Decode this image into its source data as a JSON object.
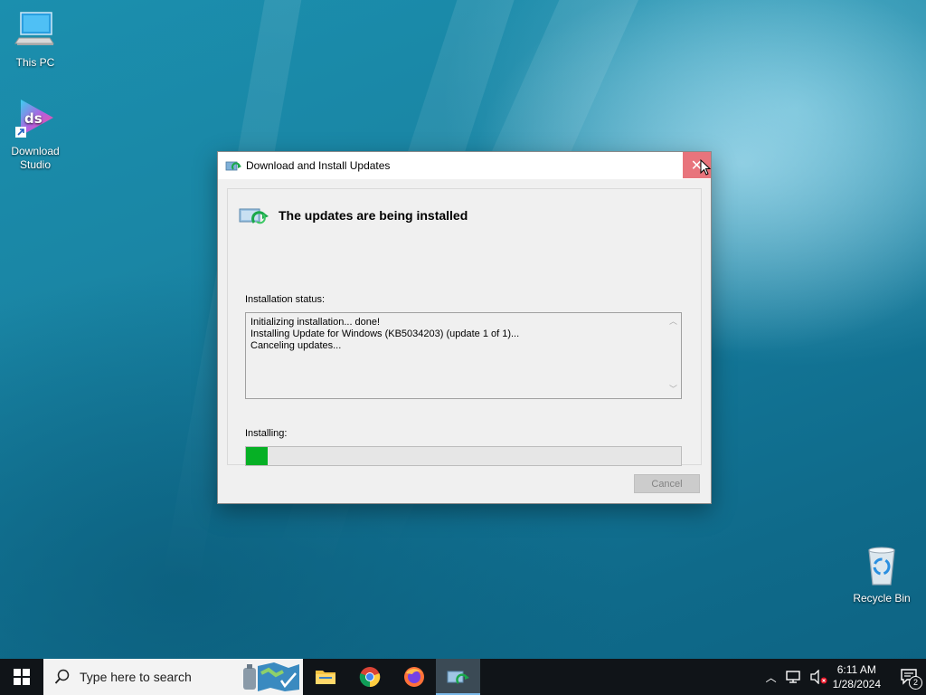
{
  "desktop": {
    "icons": [
      {
        "label": "This PC"
      },
      {
        "label": "Download Studio"
      },
      {
        "label": "Recycle Bin"
      }
    ]
  },
  "dialog": {
    "title": "Download and Install Updates",
    "close_glyph": "✕",
    "heading": "The updates are being installed",
    "status_label": "Installation status:",
    "log_lines": [
      "Initializing installation... done!",
      "Installing Update for Windows (KB5034203) (update 1 of 1)...",
      "Canceling updates..."
    ],
    "progress_label": "Installing:",
    "progress_fraction": 0.05,
    "cancel_label": "Cancel",
    "cancel_enabled": false
  },
  "taskbar": {
    "search_placeholder": "Type here to search",
    "pinned": [
      "file-explorer",
      "chrome",
      "firefox",
      "windows-update"
    ],
    "clock_time": "6:11 AM",
    "clock_date": "1/28/2024",
    "notification_count": "2"
  },
  "colors": {
    "progress_fill": "#06b025",
    "close_hover": "#e8747c",
    "taskbar": "#101418"
  }
}
